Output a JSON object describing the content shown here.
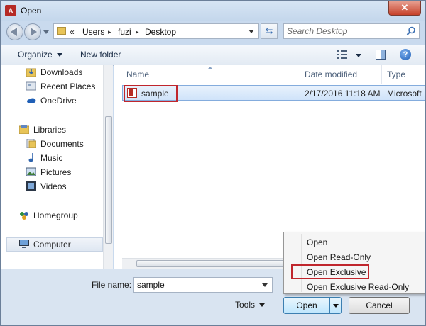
{
  "window": {
    "title": "Open",
    "app_icon_text": "A",
    "close_glyph": "✕"
  },
  "address": {
    "prefix": "«",
    "breadcrumbs": [
      "Users",
      "fuzi",
      "Desktop"
    ],
    "separator": "▸",
    "search_placeholder": "Search Desktop"
  },
  "toolbar": {
    "organize": "Organize",
    "new_folder": "New folder",
    "help_glyph": "?"
  },
  "nav": {
    "items": [
      {
        "label": "Downloads",
        "icon": "downloads-folder-icon"
      },
      {
        "label": "Recent Places",
        "icon": "recent-places-icon"
      },
      {
        "label": "OneDrive",
        "icon": "onedrive-icon"
      },
      {
        "label": "Libraries",
        "icon": "libraries-icon"
      },
      {
        "label": "Documents",
        "icon": "documents-icon"
      },
      {
        "label": "Music",
        "icon": "music-icon"
      },
      {
        "label": "Pictures",
        "icon": "pictures-icon"
      },
      {
        "label": "Videos",
        "icon": "videos-icon"
      },
      {
        "label": "Homegroup",
        "icon": "homegroup-icon"
      },
      {
        "label": "Computer",
        "icon": "computer-icon"
      }
    ],
    "selected": "Computer"
  },
  "files": {
    "columns": [
      "Name",
      "Date modified",
      "Type"
    ],
    "rows": [
      {
        "name": "sample",
        "date": "2/17/2016 11:18 AM",
        "type": "Microsoft",
        "icon": "access-file-icon"
      }
    ]
  },
  "bottom": {
    "file_name_label": "File name:",
    "file_name_value": "sample",
    "tools_label": "Tools",
    "open_label": "Open",
    "cancel_label": "Cancel"
  },
  "open_menu": {
    "items": [
      "Open",
      "Open Read-Only",
      "Open Exclusive",
      "Open Exclusive Read-Only"
    ],
    "highlighted": "Open Exclusive"
  },
  "colors": {
    "highlight_border": "#c0262d",
    "selection": "#cfe3fa",
    "chrome": "#c9daee"
  }
}
